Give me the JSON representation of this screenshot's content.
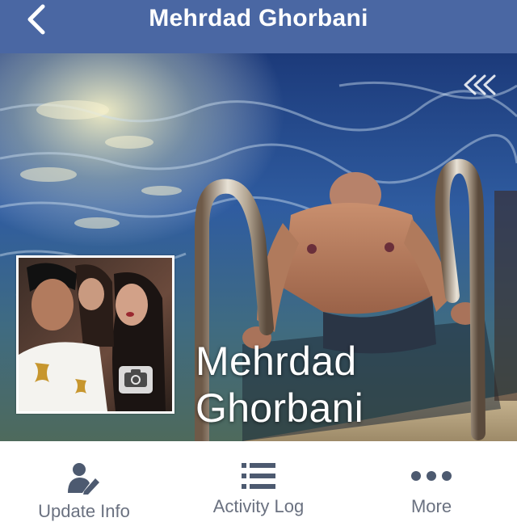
{
  "header": {
    "title": "Mehrdad Ghorbani",
    "back_icon": "chevron-left-icon"
  },
  "cover": {
    "name_line1": "Mehrdad",
    "name_line2": "Ghorbani",
    "collapse_icon": "double-chevron-left-icon",
    "camera_icon": "camera-icon"
  },
  "actions": [
    {
      "label": "Update Info",
      "icon": "person-pencil-icon"
    },
    {
      "label": "Activity Log",
      "icon": "list-icon"
    },
    {
      "label": "More",
      "icon": "ellipsis-icon"
    }
  ],
  "colors": {
    "navbar": "#4a67a3",
    "action_icon": "#4d5a70",
    "action_label": "#6a7180"
  }
}
